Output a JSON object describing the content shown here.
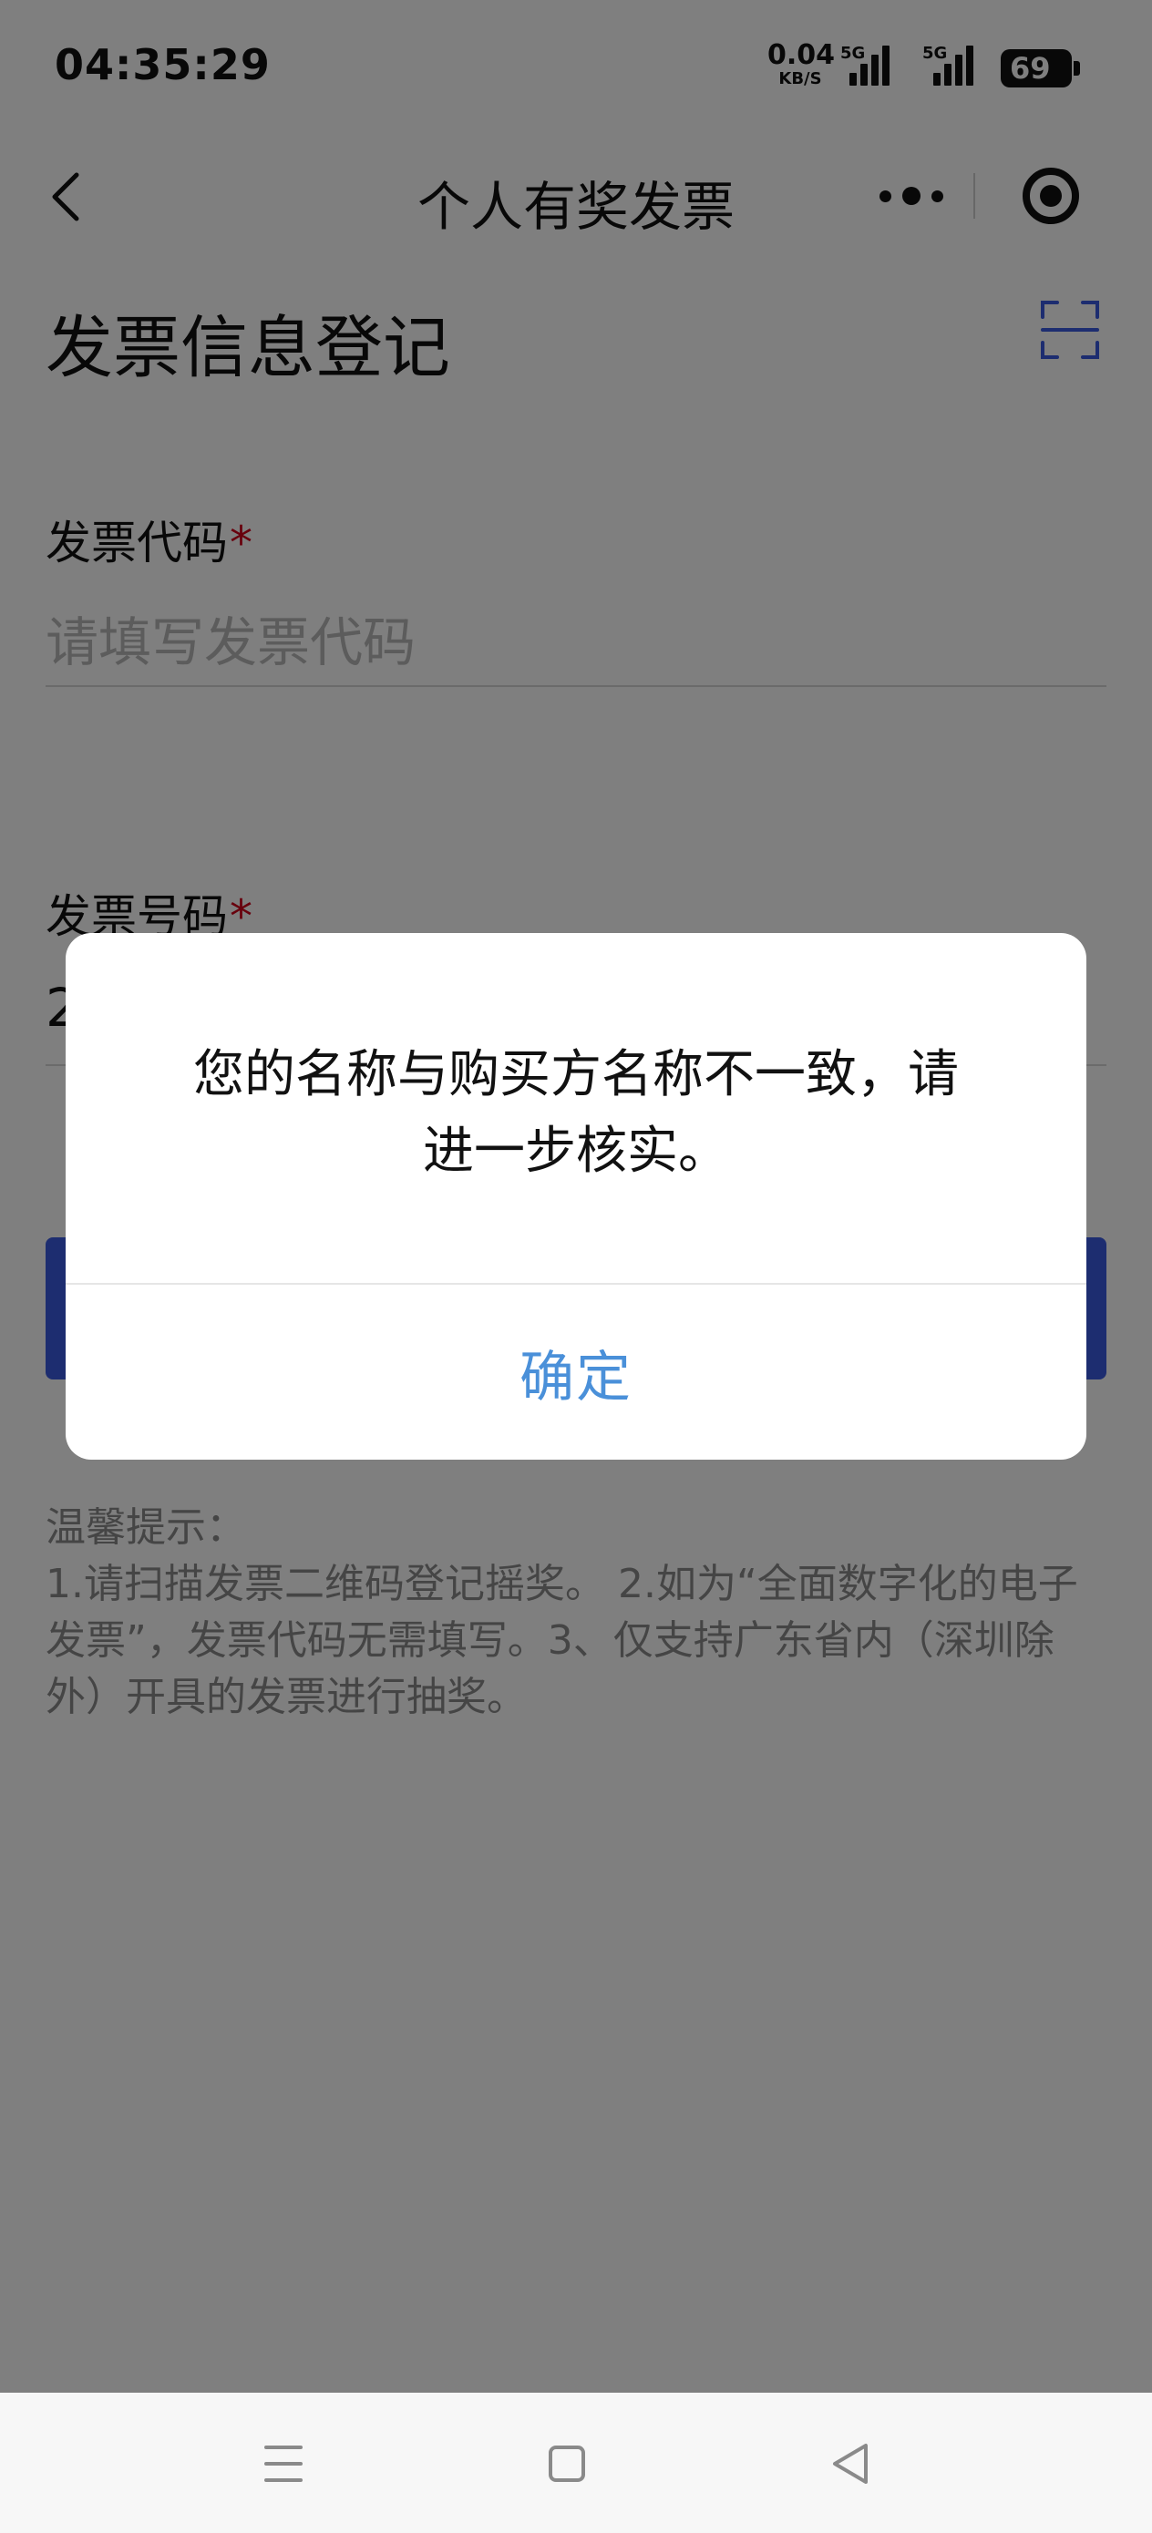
{
  "status_bar": {
    "time": "04:35:29",
    "net_speed": "0.04",
    "net_unit": "KB/S",
    "sim1_tag": "5G",
    "sim2_tag": "5G",
    "battery": "69"
  },
  "nav": {
    "title": "个人有奖发票",
    "back_icon": "chevron-left-icon",
    "more_icon": "more-dots-icon",
    "close_icon": "target-circle-icon"
  },
  "form": {
    "heading": "发票信息登记",
    "scan_icon": "scan-frame-icon",
    "invoice_code": {
      "label": "发票代码",
      "required_mark": "*",
      "placeholder": "请填写发票代码"
    },
    "invoice_number": {
      "label": "发票号码",
      "required_mark": "*",
      "value": "2"
    }
  },
  "tips": {
    "title": "温馨提示：",
    "body": "1.请扫描发票二维码登记摇奖。 2.如为“全面数字化的电子发票”，发票代码无需填写。3、仅支持广东省内（深圳除外）开具的发票进行抽奖。"
  },
  "dialog": {
    "message_line1": "您的名称与购买方名称不一致，请",
    "message_line2": "进一步核实。",
    "confirm_label": "确定"
  },
  "system_nav": {
    "menu_icon": "menu-lines-icon",
    "home_icon": "square-home-icon",
    "back_icon": "triangle-back-icon"
  },
  "colors": {
    "accent_blue": "#3a5be0",
    "confirm_text": "#4a90d9",
    "required_red": "#d0021b",
    "overlay": "rgba(0,0,0,0.5)"
  }
}
